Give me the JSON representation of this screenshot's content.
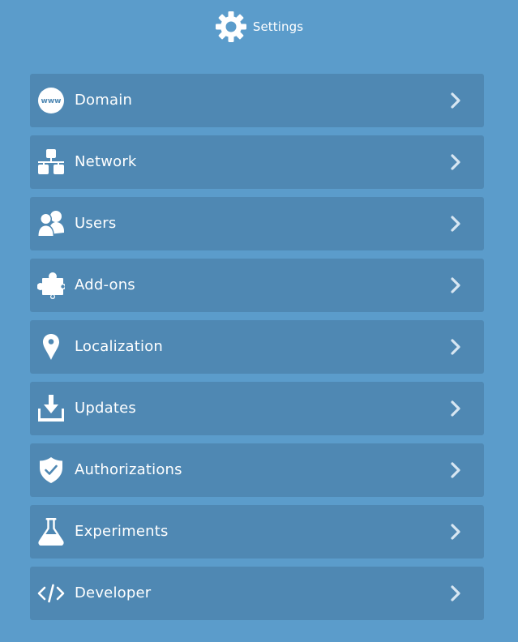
{
  "header": {
    "title": "Settings",
    "icon": "gear-icon"
  },
  "menu": {
    "items": [
      {
        "label": "Domain",
        "icon": "www-globe-icon"
      },
      {
        "label": "Network",
        "icon": "network-icon"
      },
      {
        "label": "Users",
        "icon": "users-icon"
      },
      {
        "label": "Add-ons",
        "icon": "puzzle-piece-icon"
      },
      {
        "label": "Localization",
        "icon": "map-pin-icon"
      },
      {
        "label": "Updates",
        "icon": "download-icon"
      },
      {
        "label": "Authorizations",
        "icon": "shield-check-icon"
      },
      {
        "label": "Experiments",
        "icon": "flask-icon"
      },
      {
        "label": "Developer",
        "icon": "code-icon"
      }
    ],
    "chevron_icon": "chevron-right-icon"
  },
  "colors": {
    "background": "#5b9ccb",
    "item_background": "#4f88b3",
    "foreground": "#ffffff",
    "chevron": "#d7e6f2"
  }
}
